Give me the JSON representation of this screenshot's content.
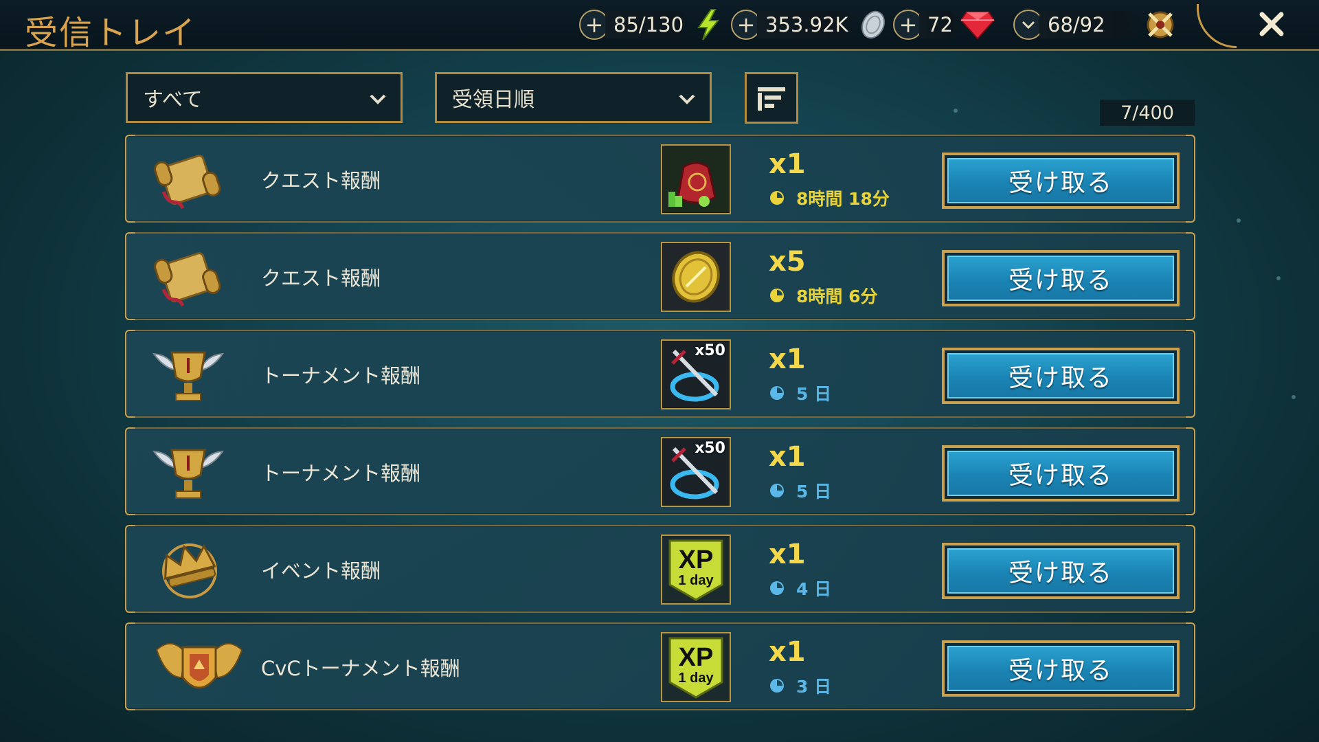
{
  "window": {
    "title": "受信トレイ"
  },
  "resources": {
    "energy": {
      "value": "85/130",
      "icon": "lightning-icon",
      "action": "plus"
    },
    "silver": {
      "value": "353.92K",
      "icon": "silver-coin-icon",
      "action": "plus"
    },
    "gems": {
      "value": "72",
      "icon": "ruby-gem-icon",
      "action": "plus"
    },
    "keys": {
      "value": "68/92",
      "icon": "arena-token-icon",
      "action": "chevron"
    }
  },
  "filters": {
    "category": {
      "selected": "すべて"
    },
    "sort": {
      "selected": "受領日順"
    }
  },
  "counter": "7/400",
  "rows": [
    {
      "source": "クエスト報酬",
      "source_icon": "quest-scroll-icon",
      "reward_icon": "red-pouch-icon",
      "reward_badge": "",
      "quantity": "x1",
      "time": "8時間 18分",
      "time_color": "#e8d43a",
      "claim": "受け取る"
    },
    {
      "source": "クエスト報酬",
      "source_icon": "quest-scroll-icon",
      "reward_icon": "gold-coin-icon",
      "reward_badge": "",
      "quantity": "x5",
      "time": "8時間 6分",
      "time_color": "#e8d43a",
      "claim": "受け取る"
    },
    {
      "source": "トーナメント報酬",
      "source_icon": "winged-trophy-icon",
      "reward_icon": "sword-swirl-icon",
      "reward_badge": "x50",
      "quantity": "x1",
      "time": "5 日",
      "time_color": "#5bb7e8",
      "claim": "受け取る"
    },
    {
      "source": "トーナメント報酬",
      "source_icon": "winged-trophy-icon",
      "reward_icon": "sword-swirl-icon",
      "reward_badge": "x50",
      "quantity": "x1",
      "time": "5 日",
      "time_color": "#5bb7e8",
      "claim": "受け取る"
    },
    {
      "source": "イベント報酬",
      "source_icon": "crown-emblem-icon",
      "reward_icon": "xp-boost-icon",
      "reward_badge": "",
      "reward_text": {
        "big": "XP",
        "small": "1 day"
      },
      "quantity": "x1",
      "time": "4 日",
      "time_color": "#5bb7e8",
      "claim": "受け取る"
    },
    {
      "source": "CvCトーナメント報酬",
      "source_icon": "winged-shield-icon",
      "reward_icon": "xp-boost-icon",
      "reward_badge": "",
      "reward_text": {
        "big": "XP",
        "small": "1 day"
      },
      "quantity": "x1",
      "time": "3 日",
      "time_color": "#5bb7e8",
      "claim": "受け取る"
    }
  ]
}
